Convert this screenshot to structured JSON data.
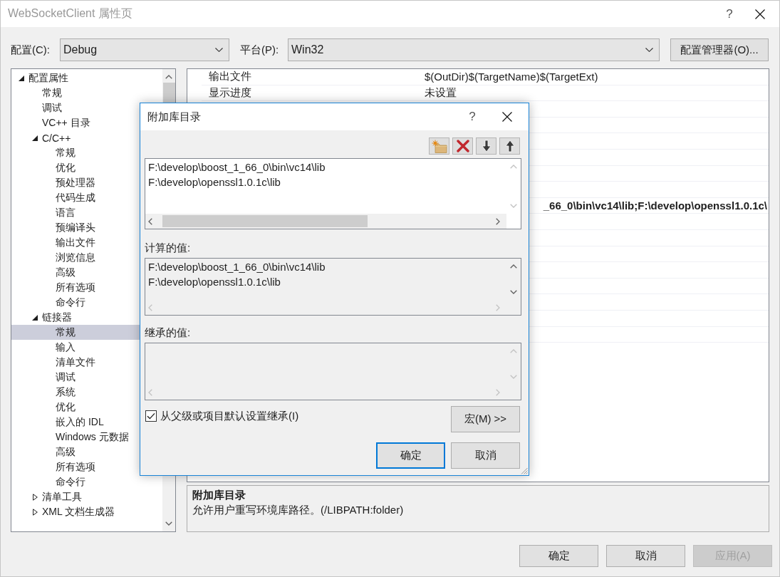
{
  "window": {
    "title": "WebSocketClient 属性页",
    "help": "?"
  },
  "config_bar": {
    "configuration": {
      "label": "配置(C):",
      "value": "Debug"
    },
    "platform": {
      "label": "平台(P):",
      "value": "Win32"
    },
    "manager_button": "配置管理器(O)..."
  },
  "tree": [
    {
      "label": "配置属性",
      "expanded": true,
      "selected": false,
      "children": [
        {
          "label": "常规",
          "selected": false
        },
        {
          "label": "调试",
          "selected": false
        },
        {
          "label": "VC++ 目录",
          "selected": false
        },
        {
          "label": "C/C++",
          "expanded": true,
          "selected": false,
          "children": [
            {
              "label": "常规",
              "selected": false
            },
            {
              "label": "优化",
              "selected": false
            },
            {
              "label": "预处理器",
              "selected": false
            },
            {
              "label": "代码生成",
              "selected": false
            },
            {
              "label": "语言",
              "selected": false
            },
            {
              "label": "预编译头",
              "selected": false
            },
            {
              "label": "输出文件",
              "selected": false
            },
            {
              "label": "浏览信息",
              "selected": false
            },
            {
              "label": "高级",
              "selected": false
            },
            {
              "label": "所有选项",
              "selected": false
            },
            {
              "label": "命令行",
              "selected": false
            }
          ]
        },
        {
          "label": "链接器",
          "expanded": true,
          "selected": false,
          "children": [
            {
              "label": "常规",
              "selected": true
            },
            {
              "label": "输入",
              "selected": false
            },
            {
              "label": "清单文件",
              "selected": false
            },
            {
              "label": "调试",
              "selected": false
            },
            {
              "label": "系统",
              "selected": false
            },
            {
              "label": "优化",
              "selected": false
            },
            {
              "label": "嵌入的 IDL",
              "selected": false
            },
            {
              "label": "Windows 元数据",
              "selected": false
            },
            {
              "label": "高级",
              "selected": false
            },
            {
              "label": "所有选项",
              "selected": false
            },
            {
              "label": "命令行",
              "selected": false
            }
          ]
        },
        {
          "label": "清单工具",
          "expanded": false,
          "selected": false
        },
        {
          "label": "XML 文档生成器",
          "expanded": false,
          "selected": false
        }
      ]
    }
  ],
  "property_grid": {
    "rows": [
      {
        "name": "输出文件",
        "value": "$(OutDir)$(TargetName)$(TargetExt)",
        "modified": false
      },
      {
        "name": "显示进度",
        "value": "未设置",
        "modified": false
      },
      {},
      {},
      {},
      {},
      {},
      {},
      {
        "value": "_66_0\\bin\\vc14\\lib;F:\\develop\\openssl1.0.1c\\",
        "modified": true
      },
      {},
      {},
      {},
      {},
      {},
      {},
      {},
      {}
    ]
  },
  "description": {
    "title": "附加库目录",
    "text": "允许用户重写环境库路径。(/LIBPATH:folder)"
  },
  "buttons": [
    {
      "label": "确定",
      "disabled": false
    },
    {
      "label": "取消",
      "disabled": false
    },
    {
      "label": "应用(A)",
      "disabled": true
    }
  ],
  "dialog": {
    "title": "附加库目录",
    "help": "?",
    "toolbar": [
      {
        "kind": "new"
      },
      {
        "kind": "delete"
      },
      {
        "kind": "down"
      },
      {
        "kind": "up"
      }
    ],
    "entries": {
      "lines": [
        "F:\\develop\\boost_1_66_0\\bin\\vc14\\lib",
        "F:\\develop\\openssl1.0.1c\\lib"
      ],
      "scroll_enabled": {
        "vertical": false,
        "horizontal": true
      }
    },
    "evaluated": {
      "label": "计算的值:",
      "lines": [
        "F:\\develop\\boost_1_66_0\\bin\\vc14\\lib",
        "F:\\develop\\openssl1.0.1c\\lib"
      ],
      "scroll_enabled": {
        "vertical": true,
        "horizontal": false
      }
    },
    "inherited": {
      "label": "继承的值:",
      "scroll_enabled": {
        "vertical": false,
        "horizontal": false
      }
    },
    "inherit_checkbox": {
      "label": "从父级或项目默认设置继承(I)",
      "checked": true
    },
    "macros_button": "宏(M) >>",
    "buttons": [
      {
        "label": "确定",
        "default": true
      },
      {
        "label": "取消",
        "default": false
      }
    ]
  }
}
